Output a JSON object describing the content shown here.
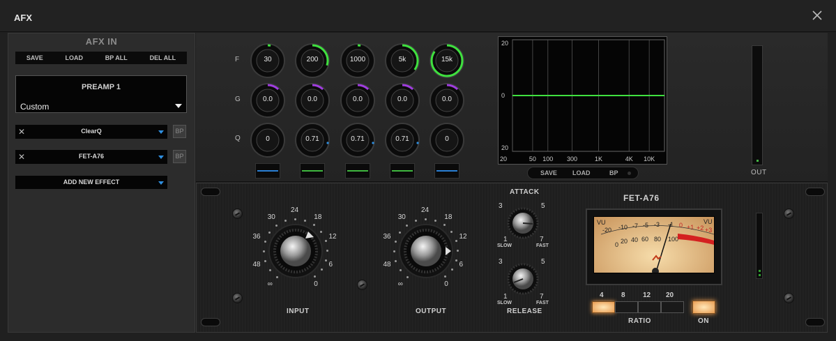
{
  "window": {
    "title": "AFX"
  },
  "chain": {
    "title": "AFX IN",
    "toolbar": [
      "SAVE",
      "LOAD",
      "BP ALL",
      "DEL ALL"
    ],
    "preamp": {
      "title": "PREAMP 1",
      "value": "Custom"
    },
    "effects": [
      {
        "name": "ClearQ",
        "bp": "BP"
      },
      {
        "name": "FET-A76",
        "bp": "BP"
      }
    ],
    "add_effect": "ADD NEW EFFECT"
  },
  "eq": {
    "row_labels": {
      "f": "F",
      "g": "G",
      "q": "Q"
    },
    "frequency": [
      "30",
      "200",
      "1000",
      "5k",
      "15k"
    ],
    "frequency_fill": [
      0.02,
      0.3,
      0.0,
      0.35,
      0.85
    ],
    "gain": [
      "0.0",
      "0.0",
      "0.0",
      "0.0",
      "0.0"
    ],
    "q": [
      "0",
      "0.71",
      "0.71",
      "0.71",
      "0"
    ],
    "band_colors": [
      "#2a7fd4",
      "#3fb83f",
      "#3fb83f",
      "#3fb83f",
      "#2a7fd4"
    ],
    "graph": {
      "y_top": "20",
      "y_mid": "0",
      "y_bottom": "20",
      "x_ticks": [
        "20",
        "50",
        "100",
        "300",
        "1K",
        "4K",
        "10K"
      ],
      "buttons": [
        "SAVE",
        "LOAD",
        "BP"
      ]
    },
    "out_label": "OUT"
  },
  "compressor": {
    "title": "FET-A76",
    "input_scale": [
      "24",
      "30",
      "18",
      "36",
      "12",
      "48",
      "6",
      "∞",
      "0"
    ],
    "output_scale": [
      "24",
      "30",
      "18",
      "36",
      "12",
      "48",
      "6",
      "∞",
      "0"
    ],
    "input_label": "INPUT",
    "output_label": "OUTPUT",
    "attack_label": "ATTACK",
    "release_label": "RELEASE",
    "small_scale": [
      "3",
      "5",
      "1",
      "7",
      "SLOW",
      "FAST"
    ],
    "vu_labels": [
      "VU",
      "-20",
      "-10",
      "-7",
      "-5",
      "-3",
      "-1",
      "0",
      "+1",
      "+2",
      "+3",
      "VU"
    ],
    "vu_lower": [
      "0",
      "20",
      "40",
      "60",
      "80",
      "100"
    ],
    "ratio_values": [
      "4",
      "8",
      "12",
      "20"
    ],
    "ratio_active": 0,
    "ratio_label": "RATIO",
    "on_label": "ON",
    "colors": {
      "accent_green": "#3fe03f",
      "accent_purple": "#a03de0",
      "led_orange": "#f0a050"
    }
  }
}
